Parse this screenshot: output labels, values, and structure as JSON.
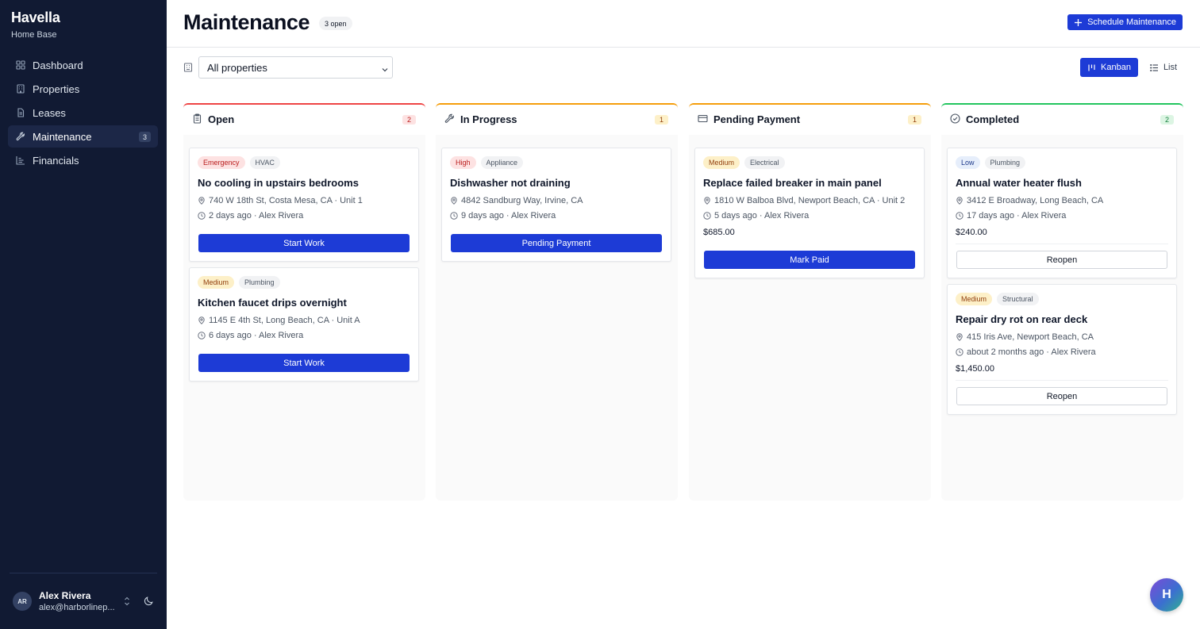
{
  "app": {
    "name": "Havella",
    "subtitle": "Home Base"
  },
  "sidebar": {
    "items": [
      {
        "label": "Dashboard",
        "icon": "grid-icon"
      },
      {
        "label": "Properties",
        "icon": "building-icon"
      },
      {
        "label": "Leases",
        "icon": "document-icon"
      },
      {
        "label": "Maintenance",
        "icon": "wrench-icon",
        "badge": "3",
        "active": true
      },
      {
        "label": "Financials",
        "icon": "chart-icon"
      }
    ]
  },
  "user": {
    "initials": "AR",
    "name": "Alex Rivera",
    "email": "alex@harborlinep..."
  },
  "header": {
    "title": "Maintenance",
    "open_count": "3 open",
    "schedule_label": "Schedule Maintenance"
  },
  "toolbar": {
    "property_filter": "All properties",
    "view_kanban": "Kanban",
    "view_list": "List",
    "active_view": "Kanban"
  },
  "colors": {
    "accent": "#1d3bd6",
    "sidebar": "#111a33",
    "open": "#ef4444",
    "in_progress": "#f59e0b",
    "pending_payment": "#f59e0b",
    "completed": "#22c55e"
  },
  "columns": [
    {
      "title": "Open",
      "count": "2",
      "icon": "clipboard-icon",
      "cards": [
        {
          "priority": "Emergency",
          "category": "HVAC",
          "title": "No cooling in upstairs bedrooms",
          "address": "740 W 18th St, Costa Mesa, CA · Unit 1",
          "time": "2 days ago · Alex Rivera",
          "action": "Start Work"
        },
        {
          "priority": "Medium",
          "category": "Plumbing",
          "title": "Kitchen faucet drips overnight",
          "address": "1145 E 4th St, Long Beach, CA · Unit A",
          "time": "6 days ago · Alex Rivera",
          "action": "Start Work"
        }
      ]
    },
    {
      "title": "In Progress",
      "count": "1",
      "icon": "wrench-icon",
      "cards": [
        {
          "priority": "High",
          "category": "Appliance",
          "title": "Dishwasher not draining",
          "address": "4842 Sandburg Way, Irvine, CA",
          "time": "9 days ago · Alex Rivera",
          "action": "Pending Payment"
        }
      ]
    },
    {
      "title": "Pending Payment",
      "count": "1",
      "icon": "credit-card-icon",
      "cards": [
        {
          "priority": "Medium",
          "category": "Electrical",
          "title": "Replace failed breaker in main panel",
          "address": "1810 W Balboa Blvd, Newport Beach, CA · Unit 2",
          "time": "5 days ago · Alex Rivera",
          "cost": "$685.00",
          "action": "Mark Paid"
        }
      ]
    },
    {
      "title": "Completed",
      "count": "2",
      "icon": "check-circle-icon",
      "cards": [
        {
          "priority": "Low",
          "category": "Plumbing",
          "title": "Annual water heater flush",
          "address": "3412 E Broadway, Long Beach, CA",
          "time": "17 days ago · Alex Rivera",
          "cost": "$240.00",
          "action": "Reopen"
        },
        {
          "priority": "Medium",
          "category": "Structural",
          "title": "Repair dry rot on rear deck",
          "address": "415 Iris Ave, Newport Beach, CA",
          "time": "about 2 months ago · Alex Rivera",
          "cost": "$1,450.00",
          "action": "Reopen"
        }
      ]
    }
  ],
  "fab": {
    "label": "H"
  }
}
